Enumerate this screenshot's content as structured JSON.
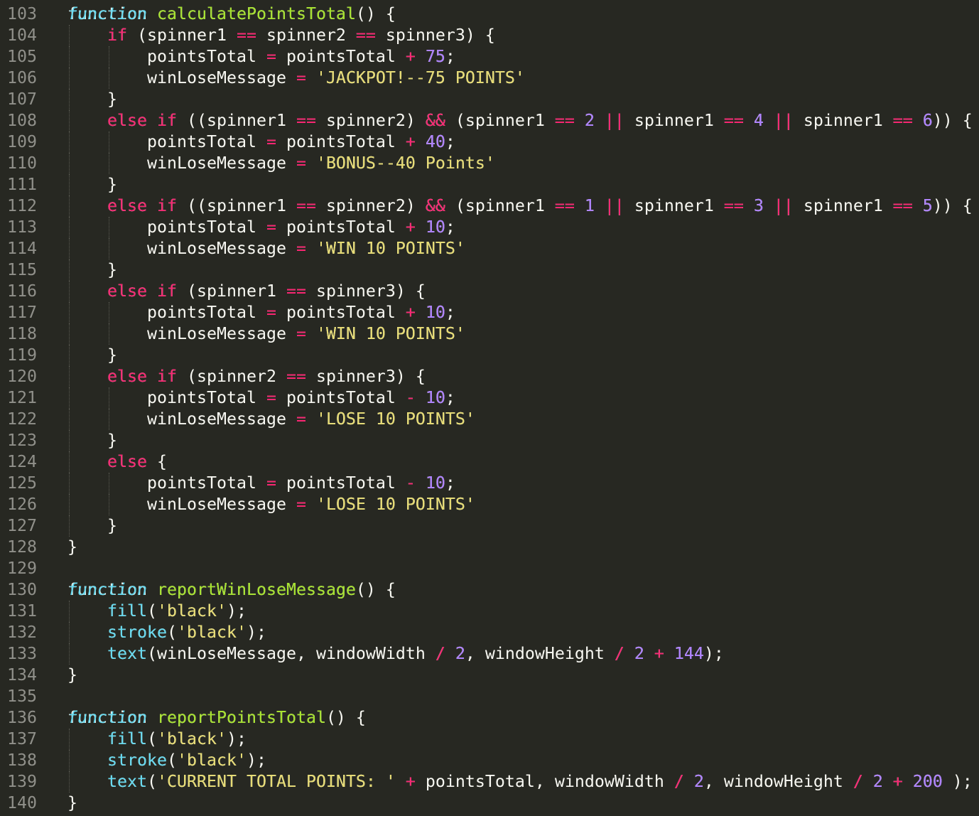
{
  "editor": {
    "theme_colors": {
      "background": "#272822",
      "text": "#f8f8f2",
      "keyword": "#f92672",
      "storage": "#66d9ef",
      "function_name": "#a6e22e",
      "string": "#e6db74",
      "number": "#ae81ff",
      "line_number": "#90908a"
    },
    "lines": [
      {
        "n": "103",
        "code": "function calculatePointsTotal() {"
      },
      {
        "n": "104",
        "code": "    if (spinner1 == spinner2 == spinner3) {"
      },
      {
        "n": "105",
        "code": "        pointsTotal = pointsTotal + 75;"
      },
      {
        "n": "106",
        "code": "        winLoseMessage = 'JACKPOT!--75 POINTS'"
      },
      {
        "n": "107",
        "code": "    }"
      },
      {
        "n": "108",
        "code": "    else if ((spinner1 == spinner2) && (spinner1 == 2 || spinner1 == 4 || spinner1 == 6)) {"
      },
      {
        "n": "109",
        "code": "        pointsTotal = pointsTotal + 40;"
      },
      {
        "n": "110",
        "code": "        winLoseMessage = 'BONUS--40 Points'"
      },
      {
        "n": "111",
        "code": "    }"
      },
      {
        "n": "112",
        "code": "    else if ((spinner1 == spinner2) && (spinner1 == 1 || spinner1 == 3 || spinner1 == 5)) {"
      },
      {
        "n": "113",
        "code": "        pointsTotal = pointsTotal + 10;"
      },
      {
        "n": "114",
        "code": "        winLoseMessage = 'WIN 10 POINTS'"
      },
      {
        "n": "115",
        "code": "    }"
      },
      {
        "n": "116",
        "code": "    else if (spinner1 == spinner3) {"
      },
      {
        "n": "117",
        "code": "        pointsTotal = pointsTotal + 10;"
      },
      {
        "n": "118",
        "code": "        winLoseMessage = 'WIN 10 POINTS'"
      },
      {
        "n": "119",
        "code": "    }"
      },
      {
        "n": "120",
        "code": "    else if (spinner2 == spinner3) {"
      },
      {
        "n": "121",
        "code": "        pointsTotal = pointsTotal - 10;"
      },
      {
        "n": "122",
        "code": "        winLoseMessage = 'LOSE 10 POINTS'"
      },
      {
        "n": "123",
        "code": "    }"
      },
      {
        "n": "124",
        "code": "    else {"
      },
      {
        "n": "125",
        "code": "        pointsTotal = pointsTotal - 10;"
      },
      {
        "n": "126",
        "code": "        winLoseMessage = 'LOSE 10 POINTS'"
      },
      {
        "n": "127",
        "code": "    }"
      },
      {
        "n": "128",
        "code": "}"
      },
      {
        "n": "129",
        "code": ""
      },
      {
        "n": "130",
        "code": "function reportWinLoseMessage() {"
      },
      {
        "n": "131",
        "code": "    fill('black');"
      },
      {
        "n": "132",
        "code": "    stroke('black');"
      },
      {
        "n": "133",
        "code": "    text(winLoseMessage, windowWidth / 2, windowHeight / 2 + 144);"
      },
      {
        "n": "134",
        "code": "}"
      },
      {
        "n": "135",
        "code": ""
      },
      {
        "n": "136",
        "code": "function reportPointsTotal() {"
      },
      {
        "n": "137",
        "code": "    fill('black');"
      },
      {
        "n": "138",
        "code": "    stroke('black');"
      },
      {
        "n": "139",
        "code": "    text('CURRENT TOTAL POINTS: ' + pointsTotal, windowWidth / 2, windowHeight / 2 + 200 );"
      },
      {
        "n": "140",
        "code": "}"
      }
    ]
  }
}
